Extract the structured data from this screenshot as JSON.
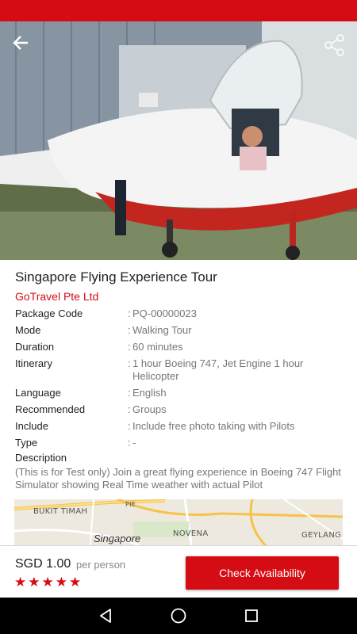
{
  "colors": {
    "accent": "#d50c14",
    "nav_bar": "#000000"
  },
  "header": {
    "back_icon": "arrow-left-icon",
    "share_icon": "share-icon"
  },
  "tour": {
    "title": "Singapore Flying Experience Tour",
    "operator": "GoTravel Pte Ltd",
    "details": [
      {
        "label": "Package Code",
        "value": "PQ-00000023"
      },
      {
        "label": "Mode",
        "value": "Walking Tour"
      },
      {
        "label": "Duration",
        "value": "60 minutes"
      },
      {
        "label": "Itinerary",
        "value": "1 hour Boeing 747, Jet Engine 1 hour Helicopter"
      },
      {
        "label": "Language",
        "value": "English"
      },
      {
        "label": "Recommended",
        "value": "Groups"
      },
      {
        "label": "Include",
        "value": "Include free photo taking with Pilots"
      },
      {
        "label": "Type",
        "value": "-"
      }
    ],
    "colon": ":",
    "description_label": "Description",
    "description": "(This is for Test only) Join a great flying experience in Boeing 747 Flight Simulator showing Real Time weather with actual Pilot"
  },
  "map": {
    "labels": [
      "BUKIT TIMAH",
      "PIE",
      "NOVENA",
      "Singapore",
      "GEYLANG"
    ]
  },
  "booking": {
    "price": "SGD 1.00",
    "per": "per person",
    "rating": 5,
    "rating_max": 5,
    "cta_label": "Check Availability"
  },
  "nav": {
    "back_icon": "nav-back-triangle-icon",
    "home_icon": "nav-home-circle-icon",
    "recents_icon": "nav-recents-square-icon"
  }
}
